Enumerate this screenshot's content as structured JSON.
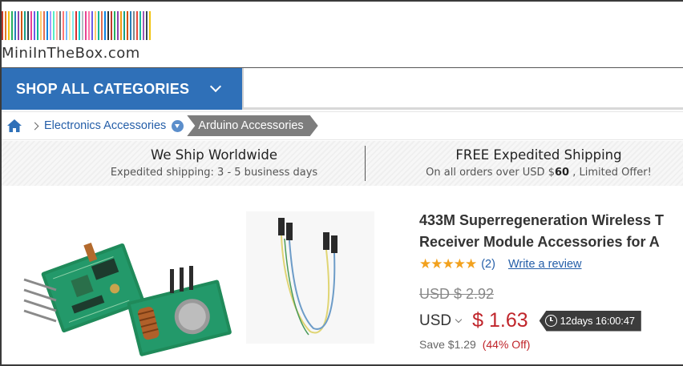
{
  "site": {
    "logo_text": "MiniInTheBox.com"
  },
  "nav": {
    "shop_all_label": "SHOP ALL CATEGORIES"
  },
  "breadcrumb": {
    "items": [
      {
        "label": "Electronics Accessories"
      },
      {
        "label": "Arduino Accessories"
      }
    ]
  },
  "shipping": {
    "left_title": "We Ship Worldwide",
    "left_sub": "Expedited shipping: 3 - 5 business days",
    "right_title": "FREE Expedited Shipping",
    "right_sub_prefix": "On all orders over USD $",
    "right_sub_amount": "60",
    "right_sub_suffix": " , Limited Offer!"
  },
  "product": {
    "title_line1": "433M Superregeneration Wireless T",
    "title_line2": "Receiver Module Accessories for A",
    "stars": "★★★★★",
    "rating_value": 5,
    "review_count": "(2)",
    "write_review": "Write a review",
    "old_price": "USD $ 2.92",
    "currency": "USD",
    "price": "$ 1.63",
    "countdown": "12days 16:00:47",
    "save_text": "Save $1.29",
    "save_pct": "(44% Off)"
  },
  "colors": {
    "brand_blue": "#2f70b8",
    "link": "#245ea8",
    "price_red": "#c0252b",
    "star": "#f2a11d",
    "timer_bg": "#3c3c3c"
  },
  "icons": {
    "home": "home-icon",
    "clock": "clock-icon",
    "chevron": "chevron-down-icon"
  }
}
